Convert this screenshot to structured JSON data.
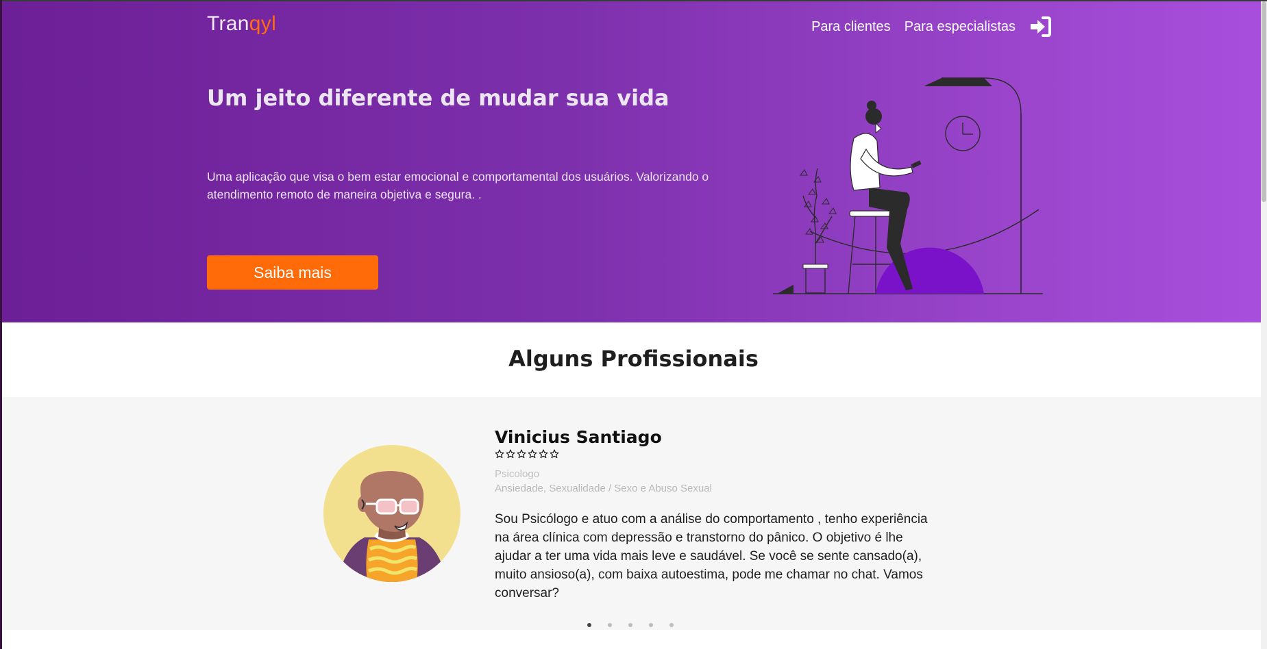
{
  "brand": {
    "logo_main": "Tran",
    "logo_accent": "qyl"
  },
  "nav": {
    "clients_label": "Para clientes",
    "specialists_label": "Para especialistas",
    "login_icon": "sign-in-icon"
  },
  "hero": {
    "headline": "Um jeito diferente de mudar sua vida",
    "subtext": "Uma aplicação que visa o bem estar emocional e comportamental dos usuários. Valorizando o atendimento remoto de maneira objetiva e segura. .",
    "cta_label": "Saiba mais",
    "illustration": "woman-on-stool-with-phone-illustration"
  },
  "professionals": {
    "title": "Alguns Profissionais",
    "current": {
      "name": "Vinicius Santiago",
      "rating": 0,
      "rating_max": 6,
      "role": "Psicologo",
      "specialties": "Ansiedade, Sexualidade / Sexo e Abuso Sexual",
      "bio": "Sou Psicólogo e atuo com a análise do comportamento , tenho experiência na área clínica com depressão e transtorno do pânico. O objetivo é lhe ajudar a ter uma vida mais leve e saudável. Se você se sente cansado(a), muito ansioso(a), com baixa autoestima, pode me chamar no chat. Vamos conversar?",
      "avatar": "avatar-illustration"
    },
    "slides_total": 5,
    "slide_active": 1
  },
  "colors": {
    "hero_gradient_start": "#6c1f96",
    "hero_gradient_end": "#a84edd",
    "accent": "#ff6b08",
    "carousel_bg": "#f6f6f6"
  }
}
